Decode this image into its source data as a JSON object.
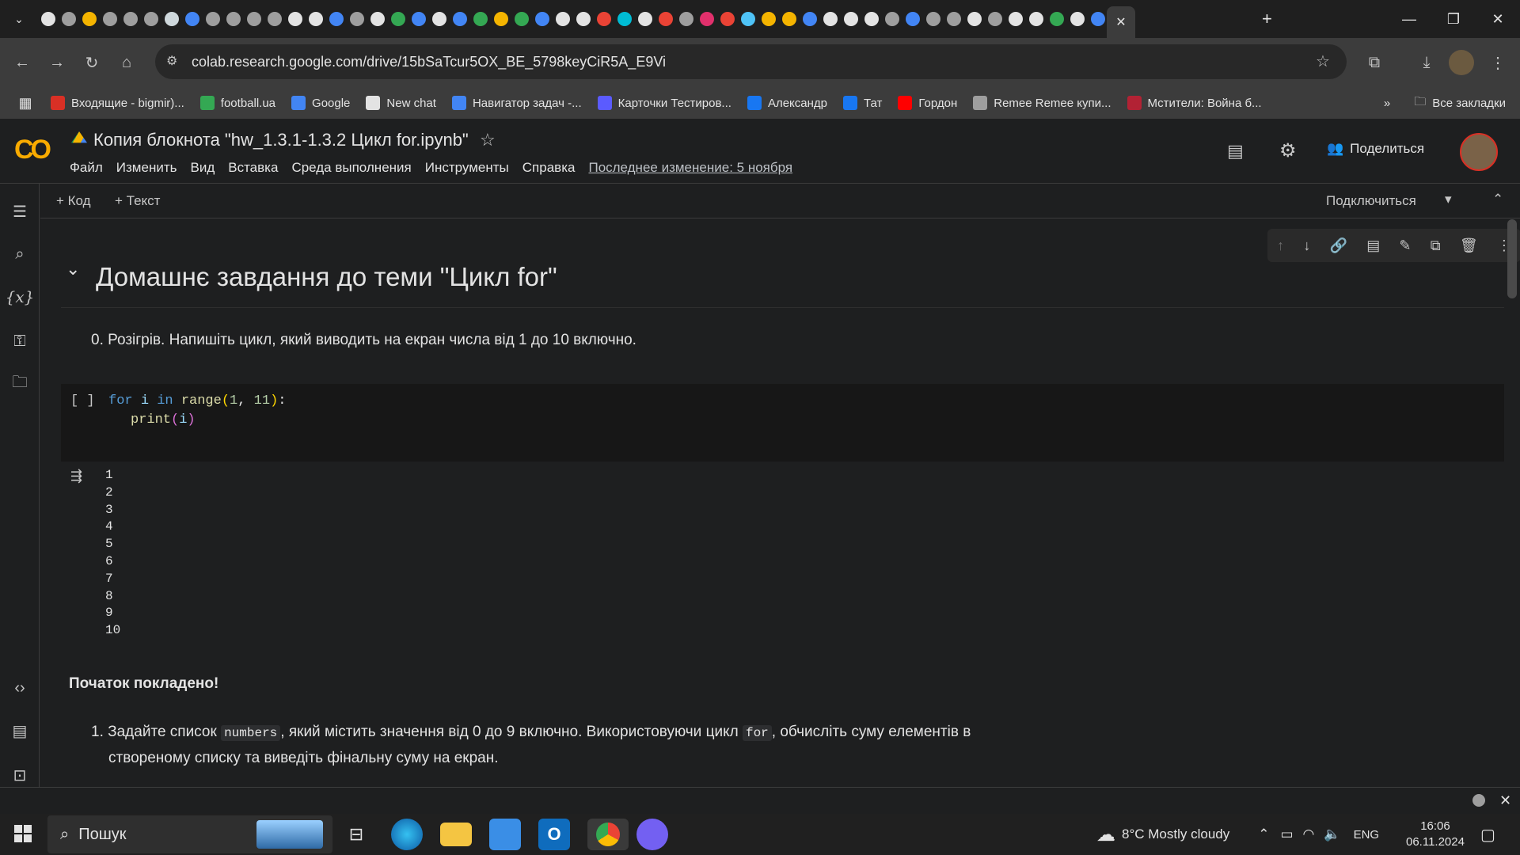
{
  "browser": {
    "url": "colab.research.google.com/drive/15bSaTcur5OX_BE_5798keyCiR5A_E9Vi",
    "bookmarks": [
      {
        "label": "Входящие - bigmir)...",
        "color": "#d93025"
      },
      {
        "label": "football.ua",
        "color": "#34a853"
      },
      {
        "label": "Google",
        "color": "#4285f4"
      },
      {
        "label": "New chat",
        "color": "#e3e3e3"
      },
      {
        "label": "Навигатор задач -...",
        "color": "#4285f4"
      },
      {
        "label": "Карточки Тестиров...",
        "color": "#5b5bff"
      },
      {
        "label": "Александр",
        "color": "#1877f2"
      },
      {
        "label": "Тат",
        "color": "#1877f2"
      },
      {
        "label": "Гордон",
        "color": "#ff0000"
      },
      {
        "label": "Remee Remee купи...",
        "color": "#9e9e9e"
      },
      {
        "label": "Мстители: Война б...",
        "color": "#b22234"
      }
    ],
    "all_bookmarks": "Все закладки"
  },
  "colab": {
    "title": "Копия блокнота \"hw_1.3.1-1.3.2 Цикл for.ipynb\"",
    "menu": [
      "Файл",
      "Изменить",
      "Вид",
      "Вставка",
      "Среда выполнения",
      "Инструменты",
      "Справка"
    ],
    "last_edit": "Последнее изменение: 5 ноября",
    "share": "Поделиться",
    "add_code": "+ Код",
    "add_text": "+ Текст",
    "connect": "Подключиться"
  },
  "notebook": {
    "heading": "Домашнє завдання до теми \"Цикл for\"",
    "task0": "0. Розігрів. Напишіть цикл, який виводить на екран числа від 1 до 10 включно.",
    "exec_count": "[ ]",
    "output": [
      "1",
      "2",
      "3",
      "4",
      "5",
      "6",
      "7",
      "8",
      "9",
      "10"
    ],
    "praise": "Початок покладено!",
    "task1": {
      "num": "1.",
      "p1": "Задайте список ",
      "code1": "numbers",
      "p2": ", який містить значення від 0 до 9 включно. Використовуючи цикл ",
      "code2": "for",
      "p3": ", обчисліть суму елементів в",
      "line2": "створеному списку та виведіть фінальну суму на екран."
    }
  },
  "taskbar": {
    "search": "Пошук",
    "weather": "8°C  Mostly cloudy",
    "lang": "ENG",
    "time": "16:06",
    "date": "06.11.2024"
  }
}
